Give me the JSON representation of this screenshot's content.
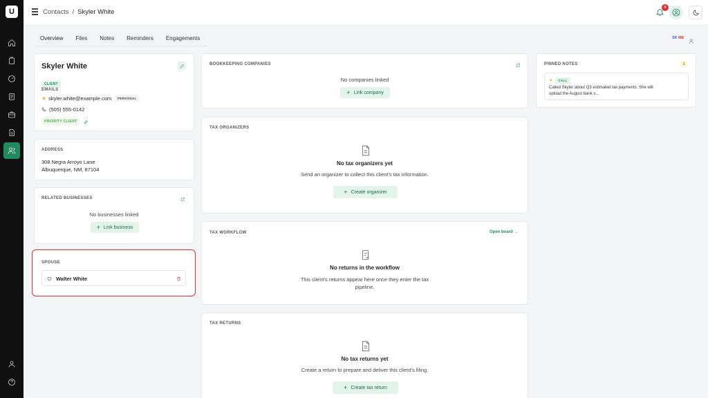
{
  "app": {
    "logo_letter": "U"
  },
  "breadcrumb": {
    "parent": "Contacts",
    "separator": "/",
    "current": "Skyler White"
  },
  "notifications": {
    "count": "4"
  },
  "tabs": [
    {
      "label": "Overview"
    },
    {
      "label": "Files"
    },
    {
      "label": "Notes"
    },
    {
      "label": "Reminders"
    },
    {
      "label": "Engagements"
    }
  ],
  "viewers": {
    "initials_1": "SK",
    "initials_2": "ME"
  },
  "contact": {
    "name": "Skyler White",
    "type_badge": "CLIENT",
    "emails_label": "EMAILS",
    "email": "skyler.white@example.com",
    "email_tag": "PERSONAL",
    "phone": "(505) 555-0142",
    "tag": "PRIORITY CLIENT"
  },
  "address": {
    "label": "ADDRESS",
    "line1": "308 Negra Arroyo Lane",
    "line2": "Albuquerque, NM, 87104"
  },
  "related_businesses": {
    "label": "RELATED BUSINESSES",
    "empty": "No businesses linked",
    "button": "Link business"
  },
  "spouse": {
    "label": "SPOUSE",
    "name": "Walter White"
  },
  "bookkeeping": {
    "label": "BOOKKEEPING COMPANIES",
    "empty": "No companies linked",
    "button": "Link company"
  },
  "tax_organizers": {
    "label": "TAX ORGANIZERS",
    "title": "No tax organizers yet",
    "desc": "Send an organizer to collect this client's tax information.",
    "button": "Create organizer"
  },
  "tax_workflow": {
    "label": "TAX WORKFLOW",
    "link": "Open board →",
    "title": "No returns in the workflow",
    "desc_line1": "This client's returns appear here once they enter the tax",
    "desc_line2": "pipeline."
  },
  "tax_returns": {
    "label": "TAX RETURNS",
    "title": "No tax returns yet",
    "desc": "Create a return to prepare and deliver this client's filing.",
    "button": "Create tax return"
  },
  "pinned_notes": {
    "label": "PINNED NOTES",
    "count": "1",
    "note_type": "CALL",
    "note_line1": "Called Skyler about Q3 estimated tax payments. She will",
    "note_line2": "upload the August bank s..."
  },
  "colors": {
    "accent": "#1f8b5e",
    "danger": "#d93636",
    "rail": "#0f0f10"
  }
}
